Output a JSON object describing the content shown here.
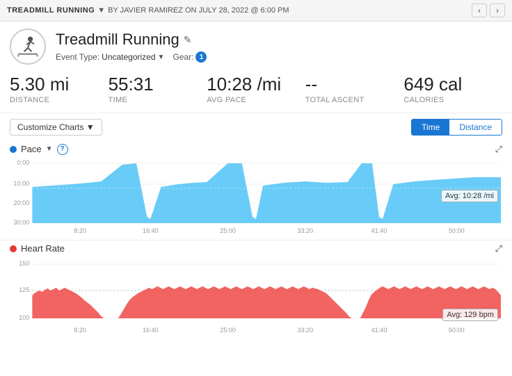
{
  "breadcrumb": {
    "title": "TREADMILL RUNNING",
    "dropdown_arrow": "▼",
    "by_text": "BY JAVIER RAMIREZ ON JULY 28, 2022 @ 6:00 PM",
    "prev_label": "‹",
    "next_label": "›"
  },
  "header": {
    "activity_title": "Treadmill Running",
    "edit_icon": "✎",
    "event_type_label": "Event Type:",
    "event_type_value": "Uncategorized",
    "gear_label": "Gear:",
    "gear_count": "1"
  },
  "stats": [
    {
      "value": "5.30 mi",
      "label": "Distance"
    },
    {
      "value": "55:31",
      "label": "Time"
    },
    {
      "value": "10:28 /mi",
      "label": "Avg Pace"
    },
    {
      "value": "--",
      "label": "Total Ascent"
    },
    {
      "value": "649 cal",
      "label": "Calories"
    }
  ],
  "toolbar": {
    "customize_label": "Customize Charts ▼",
    "toggle_time": "Time",
    "toggle_distance": "Distance"
  },
  "pace_chart": {
    "title": "Pace",
    "avg_label": "Avg: 10:28 /mi",
    "y_labels": [
      "0:00",
      "10:00",
      "20:00",
      "30:00"
    ],
    "x_labels": [
      "8:20",
      "16:40",
      "25:00",
      "33:20",
      "41:40",
      "50:00"
    ]
  },
  "hr_chart": {
    "title": "Heart Rate",
    "avg_label": "Avg: 129 bpm",
    "y_labels": [
      "150",
      "125",
      "100"
    ],
    "x_labels": [
      "8:20",
      "16:40",
      "25:00",
      "33:20",
      "41:40",
      "50:00"
    ]
  },
  "colors": {
    "blue": "#4fc3f7",
    "blue_dark": "#1976d2",
    "red": "#e53935",
    "red_fill": "#ef5350"
  }
}
